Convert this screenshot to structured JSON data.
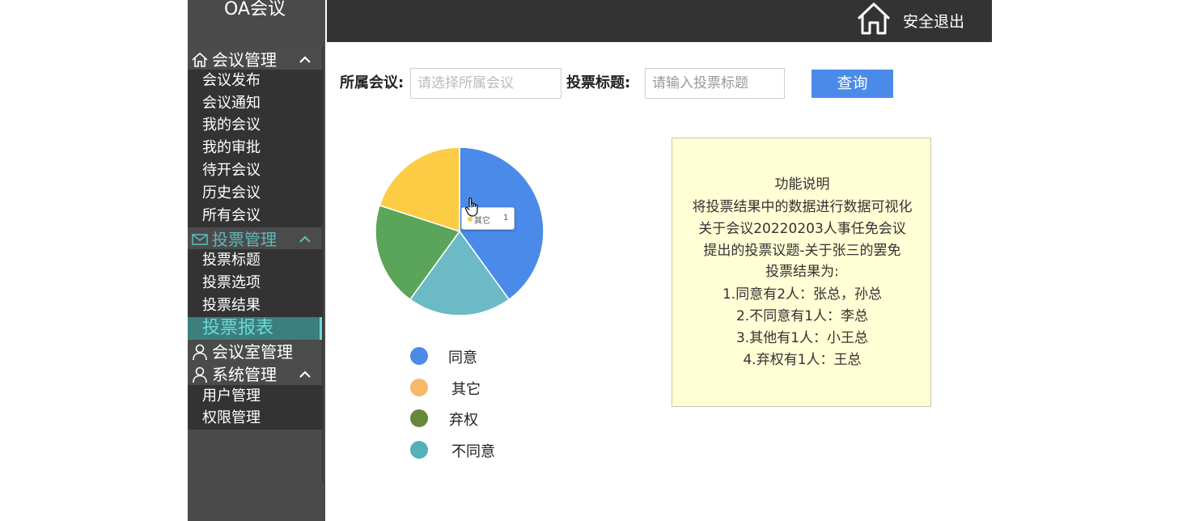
{
  "app": {
    "title": "OA会议"
  },
  "colors": {
    "accent": "#4a8bea",
    "active_teal": "#5cb8b8",
    "pie_blue": "#4a8bea",
    "pie_teal": "#6bbac5",
    "pie_green": "#5aa55a",
    "pie_yellow": "#fdcc45",
    "legend_blue": "#4a8bea",
    "legend_orange": "#f7b86a",
    "legend_olive": "#668839",
    "legend_teal": "#52b2b8"
  },
  "sidebar": {
    "groups": [
      {
        "label": "会议管理",
        "icon": "home-icon",
        "expanded": true,
        "items": [
          "会议发布",
          "会议通知",
          "我的会议",
          "我的审批",
          "待开会议",
          "历史会议",
          "所有会议"
        ]
      },
      {
        "label": "投票管理",
        "icon": "mail-icon",
        "expanded": true,
        "active": true,
        "items": [
          "投票标题",
          "投票选项",
          "投票结果",
          "投票报表"
        ]
      },
      {
        "label": "会议室管理",
        "icon": "user-icon",
        "expanded": false,
        "items": []
      },
      {
        "label": "系统管理",
        "icon": "user-icon",
        "expanded": true,
        "items": [
          "用户管理",
          "权限管理"
        ]
      }
    ],
    "active_item": "投票报表"
  },
  "header": {
    "logout_label": "安全退出",
    "home_icon": "house-icon"
  },
  "filters": {
    "meeting_label": "所属会议:",
    "meeting_placeholder": "请选择所属会议",
    "title_label": "投票标题:",
    "title_placeholder": "请输入投票标题",
    "query_label": "查询"
  },
  "chart_data": {
    "type": "pie",
    "slices": [
      {
        "value": 2,
        "color": "#4a8bea"
      },
      {
        "value": 1,
        "color": "#6bbac5"
      },
      {
        "value": 1,
        "color": "#5aa55a"
      },
      {
        "value": 1,
        "color": "#fdcc45"
      }
    ],
    "legend": [
      {
        "label": "同意",
        "color": "#4a8bea"
      },
      {
        "label": "其它",
        "color": "#f7b86a"
      },
      {
        "label": "弃权",
        "color": "#668839"
      },
      {
        "label": "不同意",
        "color": "#52b2b8"
      }
    ],
    "tooltip": {
      "name": "其它",
      "value": "1",
      "dot_color": "#fdcc45"
    }
  },
  "info": {
    "lines": [
      "功能说明",
      "将投票结果中的数据进行数据可视化",
      "关于会议20220203人事任免会议",
      "提出的投票议题-关于张三的罢免",
      "投票结果为:",
      "1.同意有2人：张总，孙总",
      "2.不同意有1人：李总",
      "3.其他有1人：小王总",
      "4.弃权有1人：王总"
    ]
  }
}
